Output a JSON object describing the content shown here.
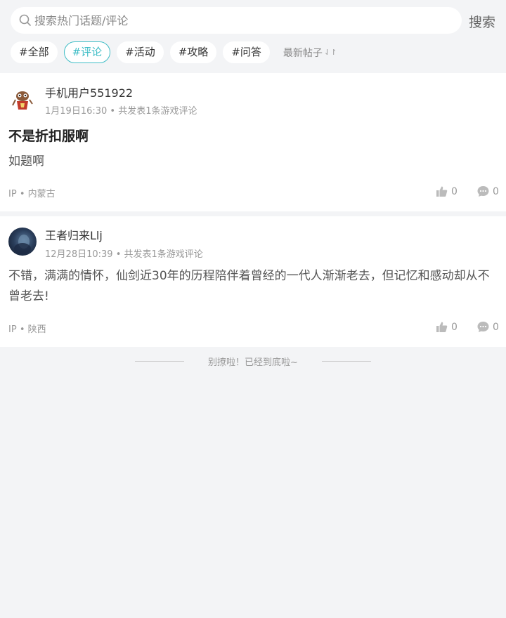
{
  "search": {
    "placeholder": "搜索热门话题/评论",
    "button_label": "搜索"
  },
  "tags": [
    {
      "label": "#全部",
      "active": false
    },
    {
      "label": "#评论",
      "active": true
    },
    {
      "label": "#活动",
      "active": false
    },
    {
      "label": "#攻略",
      "active": false
    },
    {
      "label": "#问答",
      "active": false
    }
  ],
  "sort": {
    "label": "最新帖子",
    "icon": "sort-arrows-icon"
  },
  "posts": [
    {
      "username": "手机用户551922",
      "time": "1月19日16:30",
      "stats": "共发表1条游戏评论",
      "title": "不是折扣服啊",
      "body": "如题啊",
      "ip_label": "IP",
      "ip_location": "内蒙古",
      "likes": "0",
      "comments": "0"
    },
    {
      "username": "王者归来Llj",
      "time": "12月28日10:39",
      "stats": "共发表1条游戏评论",
      "title": "",
      "body": "不错，满满的情怀，仙剑近30年的历程陪伴着曾经的一代人渐渐老去，但记忆和感动却从不曾老去!",
      "ip_label": "IP",
      "ip_location": "陕西",
      "likes": "0",
      "comments": "0"
    }
  ],
  "footer": {
    "end_text": "别撩啦！已经到底啦~"
  },
  "colors": {
    "accent": "#3ebdc6",
    "background": "#f3f4f6"
  }
}
